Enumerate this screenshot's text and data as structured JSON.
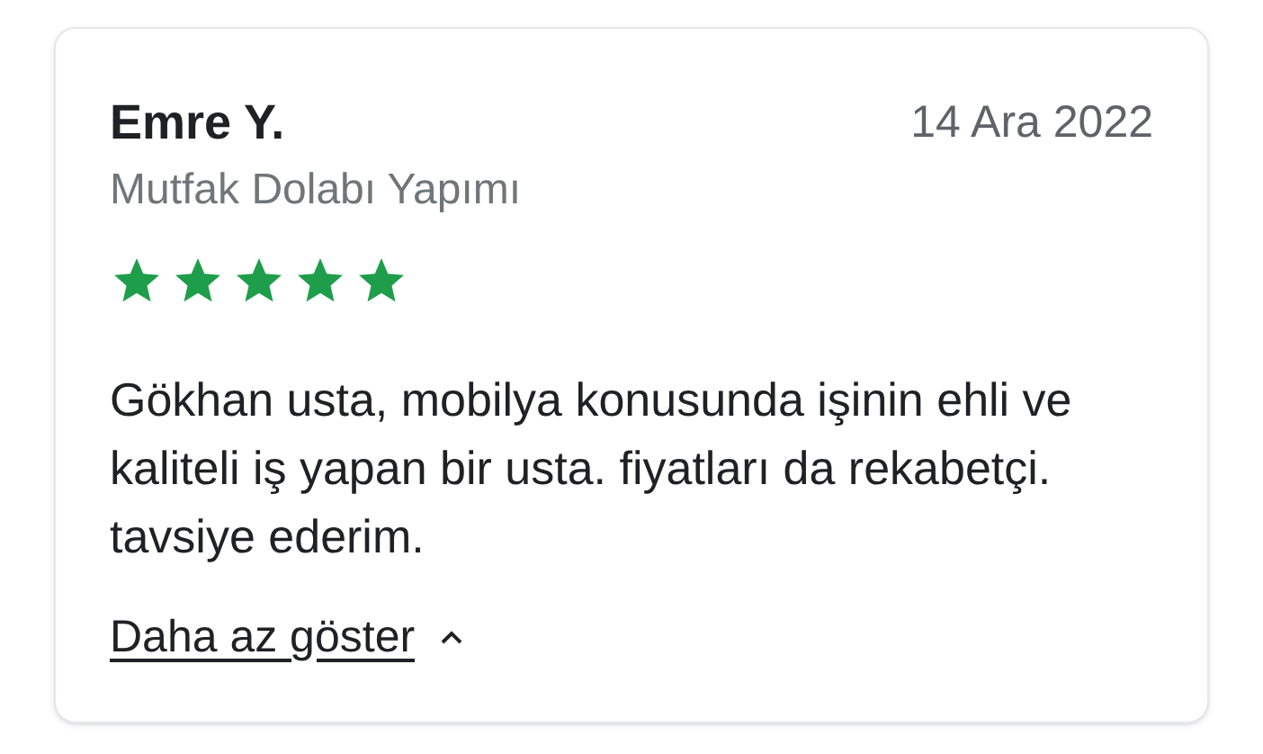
{
  "review": {
    "author": "Emre Y.",
    "date": "14 Ara 2022",
    "service": "Mutfak Dolabı Yapımı",
    "stars": 5,
    "text": "Gökhan usta, mobilya konusunda işinin ehli ve kaliteli iş yapan bir usta. fiyatları da rekabetçi. tavsiye ederim.",
    "toggle": "Daha az göster",
    "expanded": true
  }
}
